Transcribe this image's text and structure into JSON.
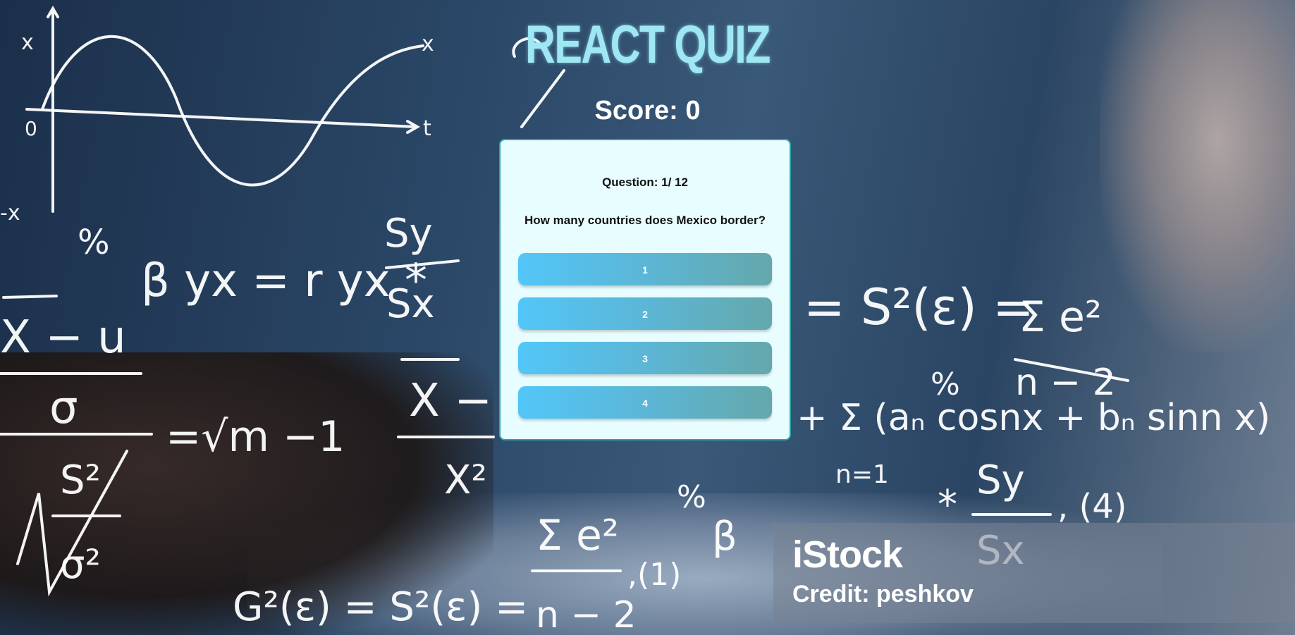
{
  "header": {
    "title": "REACT QUIZ",
    "score_text": "Score: 0"
  },
  "quiz": {
    "question_number": "Question: 1/ 12",
    "question_text": "How many countries does Mexico border?",
    "answers": [
      "1",
      "2",
      "3",
      "4"
    ]
  },
  "watermark": {
    "brand": "iStock",
    "credit": "Credit: peshkov"
  },
  "colors": {
    "title": "#9fe7f2",
    "card_bg": "#e8fdff",
    "card_border": "#27a7a7",
    "button_start": "#52c6f8",
    "button_end": "#64a8ab"
  }
}
